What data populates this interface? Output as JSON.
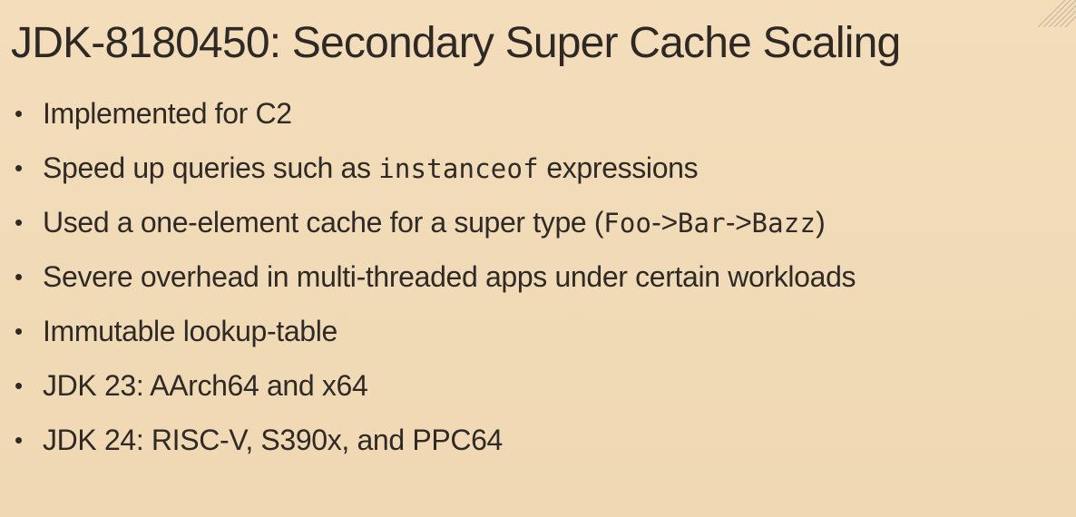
{
  "slide": {
    "title": "JDK-8180450: Secondary Super Cache Scaling",
    "bullet_symbol": "•",
    "items": [
      {
        "text": "Implemented for C2"
      },
      {
        "before": "Speed up queries such as ",
        "code": "instanceof",
        "after": " expressions"
      },
      {
        "before": "Used a one-element cache for a super type (",
        "code1": "Foo",
        "mid1": "->",
        "code2": "Bar",
        "mid2": "->",
        "code3": "Bazz",
        "after": ")"
      },
      {
        "text": "Severe overhead in multi-threaded apps under certain workloads"
      },
      {
        "text": "Immutable lookup-table"
      },
      {
        "text": "JDK 23: AArch64 and x64"
      },
      {
        "text": "JDK 24: RISC-V, S390x, and PPC64"
      }
    ]
  },
  "colors": {
    "background": "#f2dcb8",
    "text": "#2f2a25"
  },
  "icons": {
    "corner": "diagonal-stripes-icon"
  }
}
